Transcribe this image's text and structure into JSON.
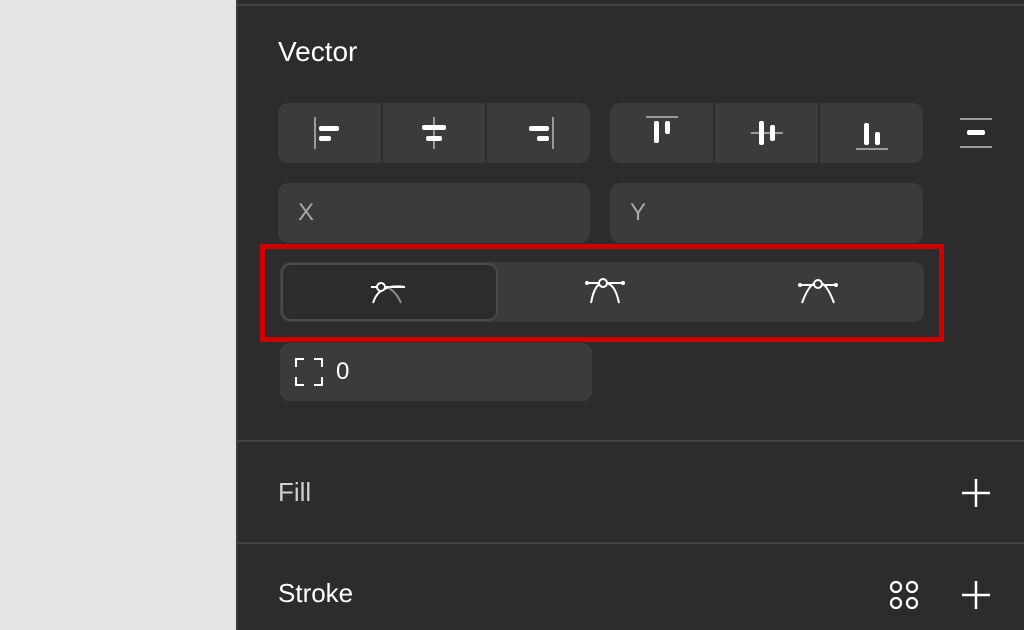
{
  "canvas": {},
  "panel": {
    "title": "Vector",
    "align": {
      "horizontal": [
        "align-left-icon",
        "align-center-horizontal-icon",
        "align-right-icon"
      ],
      "vertical": [
        "align-top-icon",
        "align-center-vertical-icon",
        "align-bottom-icon"
      ],
      "more": "distribute-icon"
    },
    "position": {
      "x_label": "X",
      "x_value": "",
      "y_label": "Y",
      "y_value": ""
    },
    "curve_modes": [
      {
        "icon": "curve-mirrored-icon",
        "active": true
      },
      {
        "icon": "curve-asymmetric-icon",
        "active": false
      },
      {
        "icon": "curve-disconnected-icon",
        "active": false
      }
    ],
    "corner_radius": {
      "icon": "corner-radius-icon",
      "value": "0"
    },
    "fill": {
      "title": "Fill",
      "add_icon": "plus-icon"
    },
    "stroke": {
      "title": "Stroke",
      "styles_icon": "styles-grid-icon",
      "add_icon": "plus-icon"
    }
  },
  "colors": {
    "panel_bg": "#2c2c2c",
    "control_bg": "#3b3b3b",
    "highlight": "#d00000",
    "canvas_bg": "#e5e5e5"
  }
}
